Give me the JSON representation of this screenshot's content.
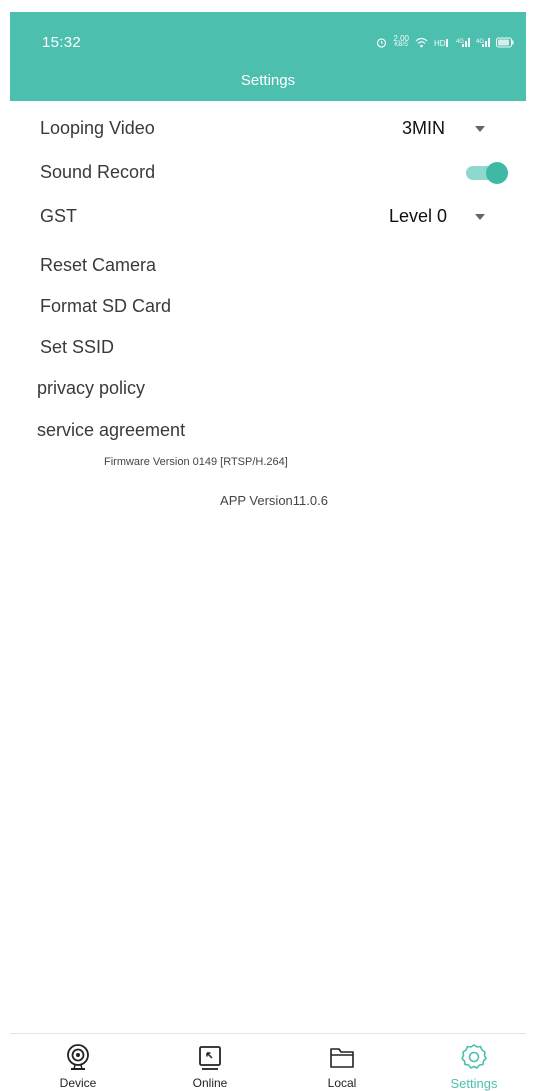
{
  "status_bar": {
    "time": "15:32",
    "speed": "2.00",
    "speed_unit": "KB/S"
  },
  "header": {
    "title": "Settings"
  },
  "settings": {
    "looping_video": {
      "label": "Looping Video",
      "value": "3MIN"
    },
    "sound_record": {
      "label": "Sound Record",
      "enabled": true
    },
    "gst": {
      "label": "GST",
      "value": "Level 0"
    },
    "reset_camera": {
      "label": "Reset Camera"
    },
    "format_sd": {
      "label": "Format SD Card"
    },
    "set_ssid": {
      "label": "Set SSID"
    },
    "privacy_policy": {
      "label": "privacy policy"
    },
    "service_agreement": {
      "label": "service agreement"
    }
  },
  "firmware_version": "Firmware Version  0149 [RTSP/H.264]",
  "app_version": "APP Version11.0.6",
  "bottom_nav": {
    "device": "Device",
    "online": "Online",
    "local": "Local",
    "settings": "Settings"
  },
  "colors": {
    "accent": "#4dbfaf",
    "toggle_on": "#3fb8a6"
  }
}
